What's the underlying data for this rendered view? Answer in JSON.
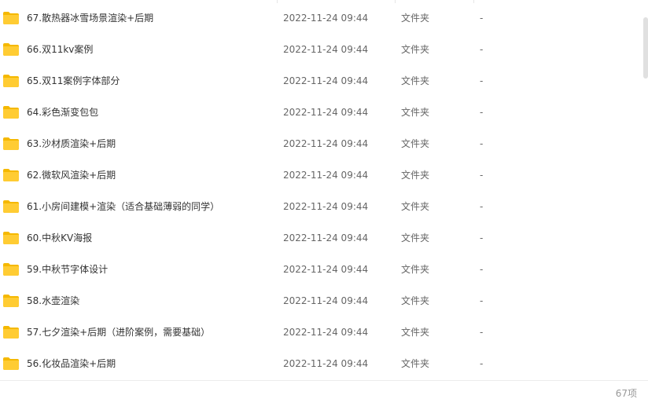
{
  "colors": {
    "folder": "#ffcc33",
    "folder_back": "#f5b800",
    "text": "#333333",
    "muted": "#666666",
    "footer_text": "#999999"
  },
  "rows": [
    {
      "name": "67.散热器冰雪场景渲染+后期",
      "date": "2022-11-24 09:44",
      "type": "文件夹",
      "size": "-",
      "icon": "folder-icon"
    },
    {
      "name": "66.双11kv案例",
      "date": "2022-11-24 09:44",
      "type": "文件夹",
      "size": "-",
      "icon": "folder-icon"
    },
    {
      "name": "65.双11案例字体部分",
      "date": "2022-11-24 09:44",
      "type": "文件夹",
      "size": "-",
      "icon": "folder-icon"
    },
    {
      "name": "64.彩色渐变包包",
      "date": "2022-11-24 09:44",
      "type": "文件夹",
      "size": "-",
      "icon": "folder-icon"
    },
    {
      "name": "63.沙材质渲染+后期",
      "date": "2022-11-24 09:44",
      "type": "文件夹",
      "size": "-",
      "icon": "folder-icon"
    },
    {
      "name": "62.微软风渲染+后期",
      "date": "2022-11-24 09:44",
      "type": "文件夹",
      "size": "-",
      "icon": "folder-icon"
    },
    {
      "name": "61.小房间建模+渲染（适合基础薄弱的同学）",
      "date": "2022-11-24 09:44",
      "type": "文件夹",
      "size": "-",
      "icon": "folder-icon"
    },
    {
      "name": "60.中秋KV海报",
      "date": "2022-11-24 09:44",
      "type": "文件夹",
      "size": "-",
      "icon": "folder-icon"
    },
    {
      "name": "59.中秋节字体设计",
      "date": "2022-11-24 09:44",
      "type": "文件夹",
      "size": "-",
      "icon": "folder-icon"
    },
    {
      "name": "58.水壶渲染",
      "date": "2022-11-24 09:44",
      "type": "文件夹",
      "size": "-",
      "icon": "folder-icon"
    },
    {
      "name": "57.七夕渲染+后期（进阶案例，需要基础）",
      "date": "2022-11-24 09:44",
      "type": "文件夹",
      "size": "-",
      "icon": "folder-icon"
    },
    {
      "name": "56.化妆品渲染+后期",
      "date": "2022-11-24 09:44",
      "type": "文件夹",
      "size": "-",
      "icon": "folder-icon"
    }
  ],
  "footer": {
    "count": "67项"
  }
}
